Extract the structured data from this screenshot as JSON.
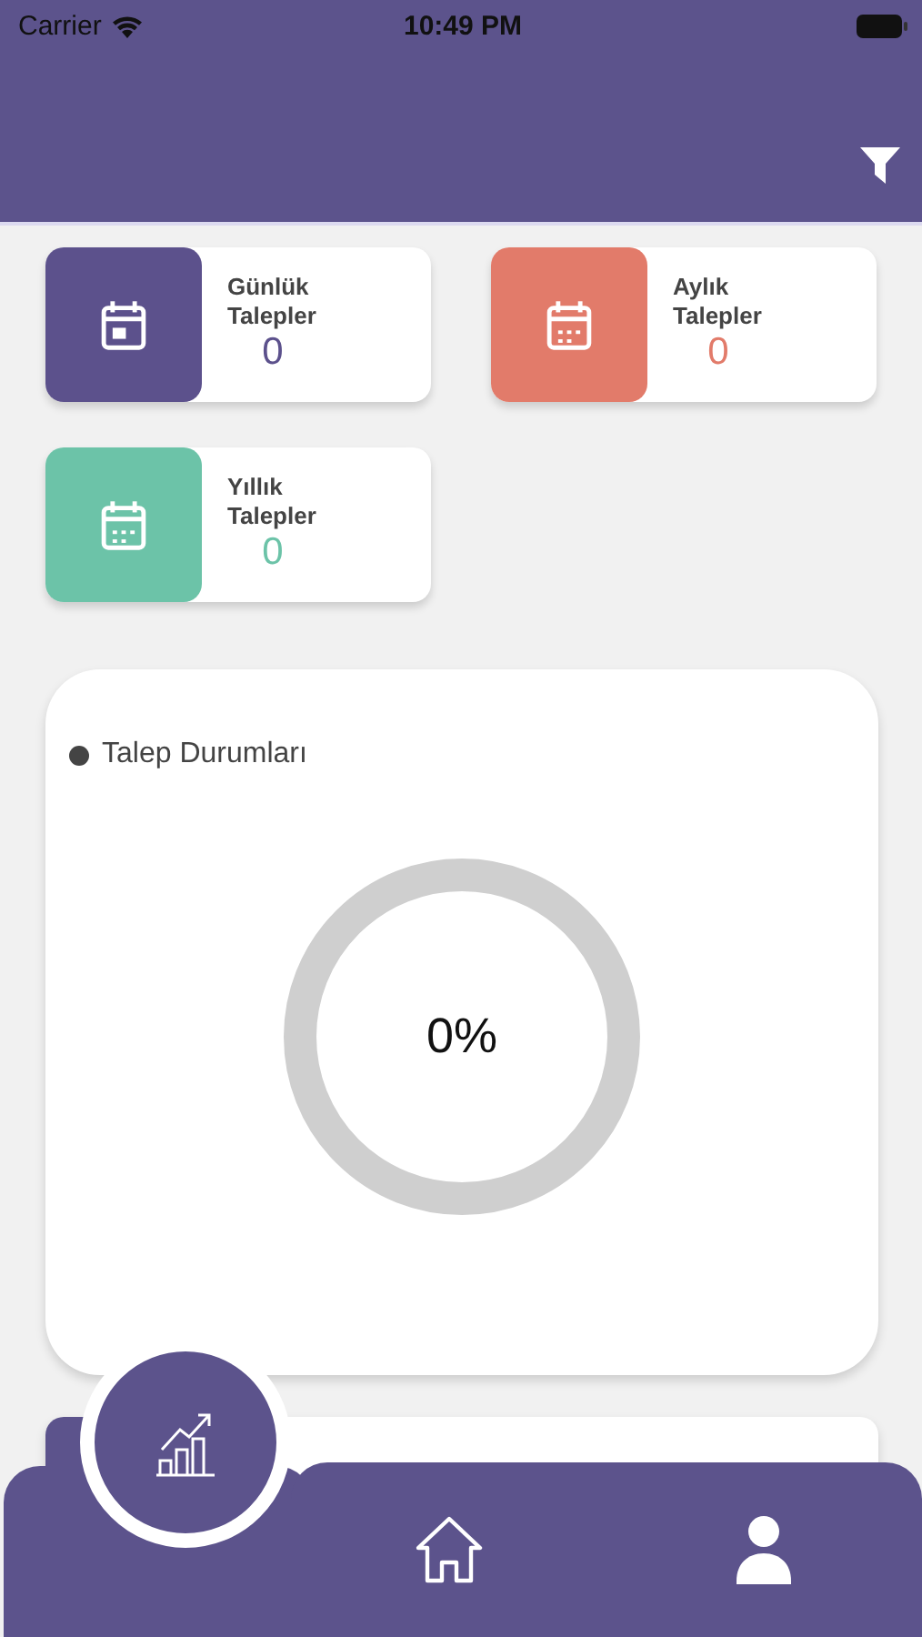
{
  "status_bar": {
    "carrier": "Carrier",
    "time": "10:49 PM"
  },
  "stat_cards": [
    {
      "title": "Günlük Talepler",
      "count": "0",
      "color": "#5c518c",
      "kind": "day"
    },
    {
      "title": "Aylık Talepler",
      "count": "0",
      "color": "#e27b6a",
      "kind": "month"
    },
    {
      "title": "Yıllık Talepler",
      "count": "0",
      "color": "#6cc3a8",
      "kind": "month"
    }
  ],
  "status_chart": {
    "title": "Talep Durumları",
    "value": "0%"
  },
  "tab_bar": [
    {
      "kind": "chart",
      "selected": true
    },
    {
      "kind": "home",
      "selected": false
    },
    {
      "kind": "user",
      "selected": false
    }
  ]
}
